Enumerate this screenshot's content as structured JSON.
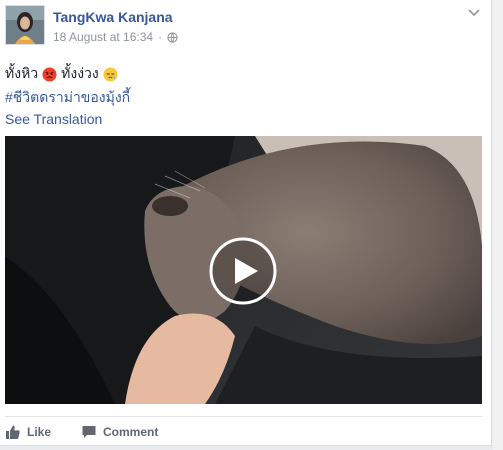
{
  "post": {
    "author": "TangKwa Kanjana",
    "timestamp": "18 August at 16:34",
    "text": "ทั้งหิว",
    "text_part2": "ทั้งง่วง",
    "emoji_1": "angry-face-emoji",
    "emoji_2": "sleepy-face-emoji",
    "hashtag": "#ชีวิตดราม่าของมุ้งกี้",
    "translation_link": "See Translation",
    "video": {
      "icon": "play-icon",
      "subject": "otter"
    }
  },
  "actions": {
    "like_label": "Like",
    "comment_label": "Comment"
  },
  "colors": {
    "link": "#365899",
    "meta": "#90949c",
    "text": "#1d2129",
    "action": "#606770"
  }
}
